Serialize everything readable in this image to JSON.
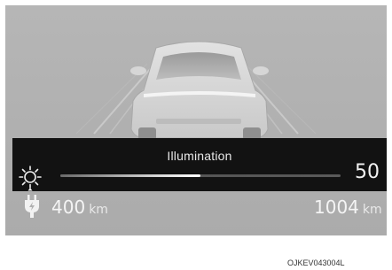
{
  "illumination": {
    "title": "Illumination",
    "value": "50",
    "level_fraction": 0.5
  },
  "range": {
    "left_value": "400",
    "left_unit": "km",
    "right_value": "1004",
    "right_unit": "km"
  },
  "caption": "OJKEV043004L",
  "icons": {
    "brightness": "sun-brightness-icon",
    "charging": "ev-plug-icon"
  },
  "colors": {
    "cluster_background": "#b0b0b0",
    "overlay_bar": "#121212",
    "text": "#f2f2f2"
  }
}
